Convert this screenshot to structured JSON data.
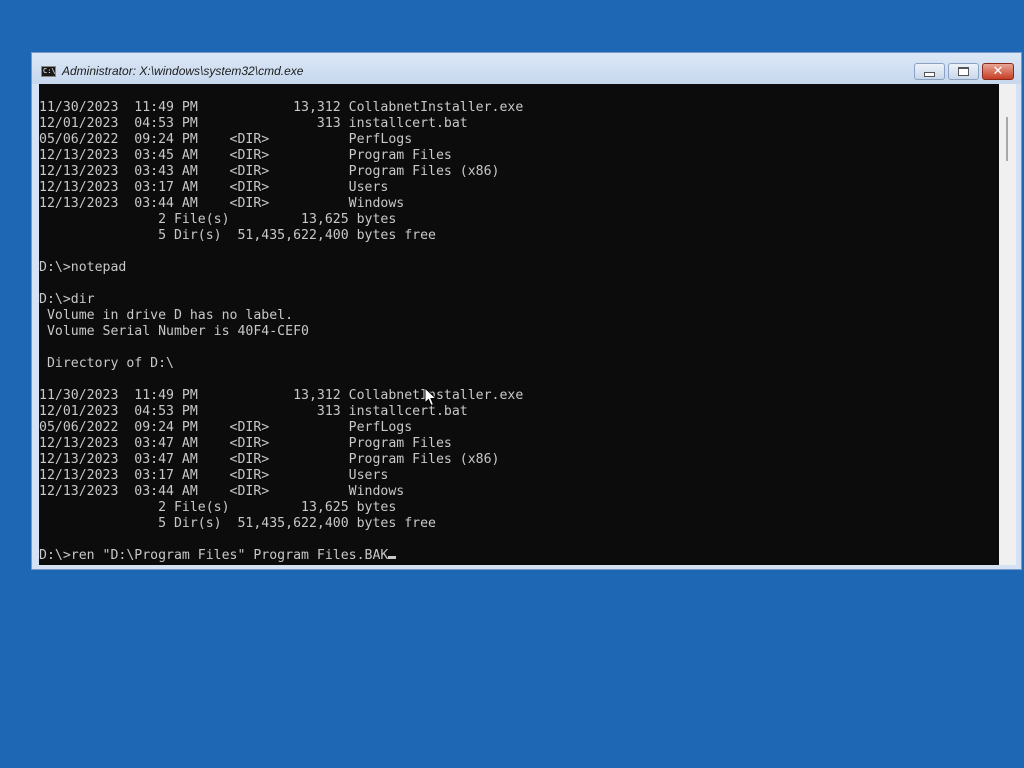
{
  "window": {
    "title": "Administrator: X:\\windows\\system32\\cmd.exe",
    "icon": "cmd-icon",
    "buttons": {
      "minimize_icon": "minimize-icon",
      "maximize_icon": "maximize-icon",
      "close_icon": "close-icon",
      "close_glyph": "✕"
    }
  },
  "console": {
    "lines": [
      "11/30/2023  11:49 PM            13,312 CollabnetInstaller.exe",
      "12/01/2023  04:53 PM               313 installcert.bat",
      "05/06/2022  09:24 PM    <DIR>          PerfLogs",
      "12/13/2023  03:45 AM    <DIR>          Program Files",
      "12/13/2023  03:43 AM    <DIR>          Program Files (x86)",
      "12/13/2023  03:17 AM    <DIR>          Users",
      "12/13/2023  03:44 AM    <DIR>          Windows",
      "               2 File(s)         13,625 bytes",
      "               5 Dir(s)  51,435,622,400 bytes free",
      "",
      "D:\\>notepad",
      "",
      "D:\\>dir",
      " Volume in drive D has no label.",
      " Volume Serial Number is 40F4-CEF0",
      "",
      " Directory of D:\\",
      "",
      "11/30/2023  11:49 PM            13,312 CollabnetInstaller.exe",
      "12/01/2023  04:53 PM               313 installcert.bat",
      "05/06/2022  09:24 PM    <DIR>          PerfLogs",
      "12/13/2023  03:47 AM    <DIR>          Program Files",
      "12/13/2023  03:47 AM    <DIR>          Program Files (x86)",
      "12/13/2023  03:17 AM    <DIR>          Users",
      "12/13/2023  03:44 AM    <DIR>          Windows",
      "               2 File(s)         13,625 bytes",
      "               5 Dir(s)  51,435,622,400 bytes free",
      ""
    ],
    "prompt_line": "D:\\>ren \"D:\\Program Files\" Program Files.BAK"
  },
  "colors": {
    "desktop": "#1e67b4",
    "console_bg": "#0c0c0c",
    "console_fg": "#c8c8c8",
    "close_button": "#c63e24"
  }
}
